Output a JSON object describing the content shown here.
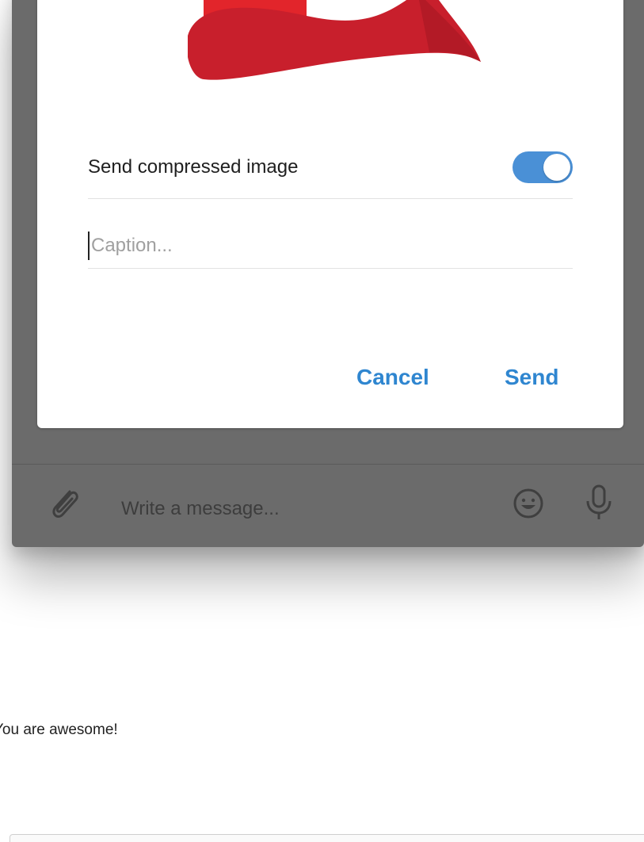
{
  "dialog": {
    "compress_label": "Send compressed image",
    "compress_enabled": true,
    "caption_placeholder": "Caption...",
    "caption_value": "",
    "cancel_label": "Cancel",
    "send_label": "Send"
  },
  "composer": {
    "placeholder": "Write a message...",
    "icons": [
      "paperclip-icon",
      "emoji-icon",
      "microphone-icon"
    ]
  },
  "background": {
    "text": "You are awesome!"
  },
  "colors": {
    "accent": "#2f86d0",
    "toggle_on": "#4a90d6",
    "cap_red": "#e2252b",
    "overlay": "#6b6b6b"
  }
}
